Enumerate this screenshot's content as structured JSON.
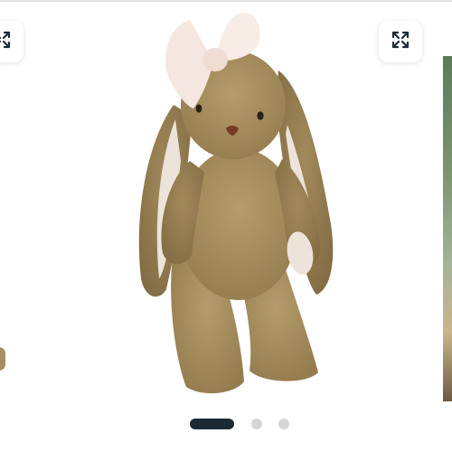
{
  "gallery": {
    "product_image_alt": "",
    "expand_buttons": [
      {
        "icon": "expand-arrows-icon"
      },
      {
        "icon": "expand-arrows-icon"
      }
    ],
    "pagination": {
      "total": 3,
      "current": 1
    },
    "colors": {
      "accent": "#1b2b36",
      "dot_inactive": "#d6d6d6",
      "plush_fur": "#a88f5f",
      "bow": "#f5e6df"
    }
  }
}
